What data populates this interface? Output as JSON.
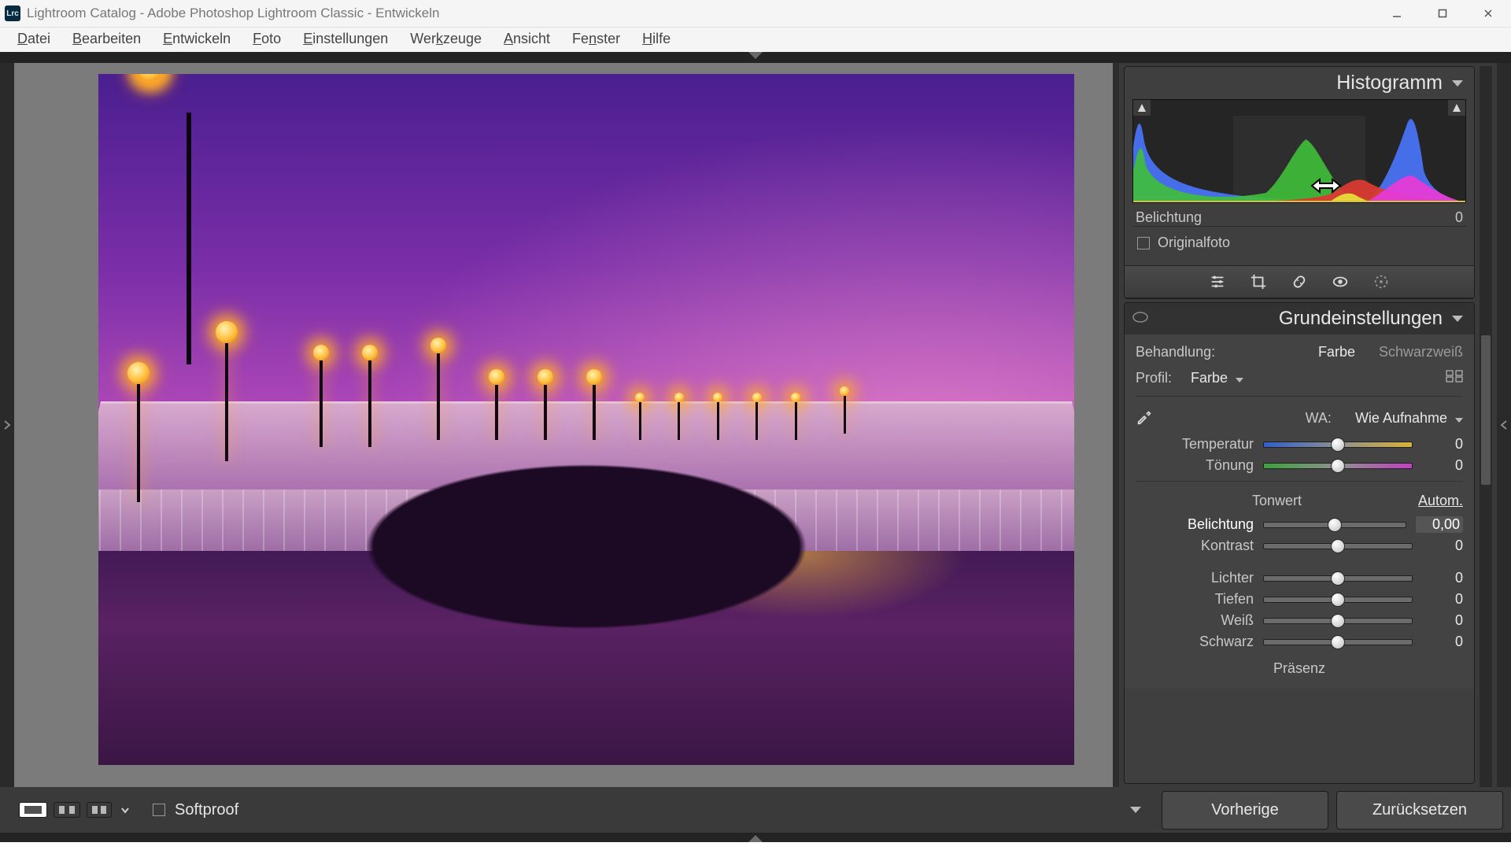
{
  "titlebar": {
    "icon_text": "Lrc",
    "title": "Lightroom Catalog - Adobe Photoshop Lightroom Classic - Entwickeln"
  },
  "menu": {
    "items": [
      {
        "ul": "D",
        "rest": "atei"
      },
      {
        "ul": "B",
        "rest": "earbeiten"
      },
      {
        "ul": "E",
        "rest": "ntwickeln"
      },
      {
        "ul": "F",
        "rest": "oto"
      },
      {
        "ul": "E",
        "rest": "instellungen"
      },
      {
        "ul": "",
        "rest": "Werkzeuge",
        "mid_ul": "k",
        "pre": "Wer",
        "post": "zeuge"
      },
      {
        "ul": "A",
        "rest": "nsicht"
      },
      {
        "ul": "",
        "rest": "Fenster",
        "mid_ul": "n",
        "pre": "Fe",
        "post": "ster"
      },
      {
        "ul": "H",
        "rest": "ilfe"
      }
    ]
  },
  "histogram": {
    "title": "Histogramm",
    "value_label": "Belichtung",
    "value": "0",
    "original_label": "Originalfoto"
  },
  "tools": [
    "sliders-icon",
    "crop-icon",
    "heal-icon",
    "redeye-icon",
    "radial-icon"
  ],
  "basic_panel": {
    "title": "Grundeinstellungen",
    "treatment_label": "Behandlung:",
    "treatment_color": "Farbe",
    "treatment_bw": "Schwarzweiß",
    "profile_label": "Profil:",
    "profile_value": "Farbe",
    "wb_label": "WA:",
    "wb_value": "Wie Aufnahme",
    "sliders_wb": [
      {
        "label": "Temperatur",
        "value": "0",
        "grad": "grad-temp"
      },
      {
        "label": "Tönung",
        "value": "0",
        "grad": "grad-tint"
      }
    ],
    "tone_title": "Tonwert",
    "tone_auto": "Autom.",
    "sliders_tone": [
      {
        "label": "Belichtung",
        "value": "0,00",
        "bold": true
      },
      {
        "label": "Kontrast",
        "value": "0"
      }
    ],
    "sliders_tone2": [
      {
        "label": "Lichter",
        "value": "0"
      },
      {
        "label": "Tiefen",
        "value": "0"
      },
      {
        "label": "Weiß",
        "value": "0"
      },
      {
        "label": "Schwarz",
        "value": "0"
      }
    ],
    "presence_title": "Präsenz"
  },
  "footer": {
    "softproof": "Softproof",
    "prev_btn": "Vorherige",
    "reset_btn": "Zurücksetzen"
  }
}
